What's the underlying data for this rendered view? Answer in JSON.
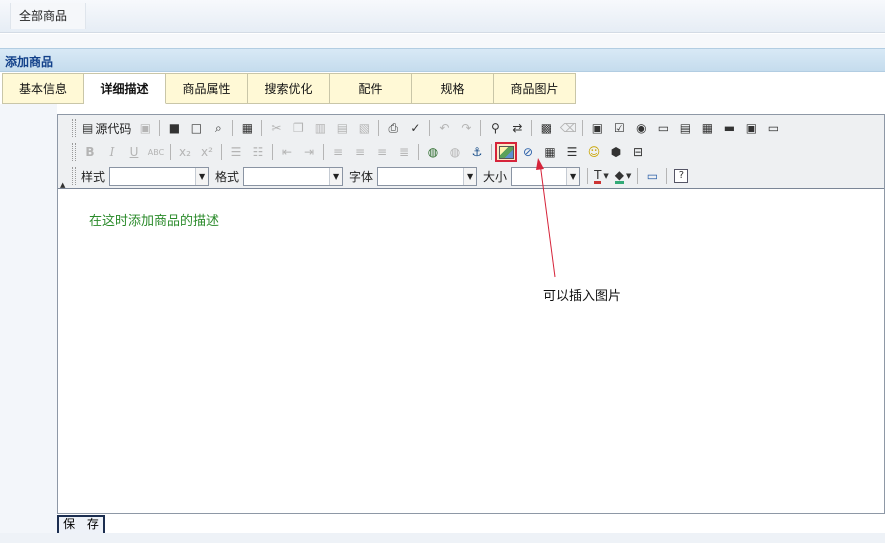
{
  "breadcrumb": "全部商品",
  "panel_title": "添加商品",
  "tabs": [
    {
      "label": "基本信息"
    },
    {
      "label": "详细描述",
      "active": true
    },
    {
      "label": "商品属性"
    },
    {
      "label": "搜索优化"
    },
    {
      "label": "配件"
    },
    {
      "label": "规格"
    },
    {
      "label": "商品图片"
    }
  ],
  "toolbar": {
    "source_label": "源代码",
    "combos": [
      {
        "label": "样式",
        "value": ""
      },
      {
        "label": "格式",
        "value": ""
      },
      {
        "label": "字体",
        "value": ""
      },
      {
        "label": "大小",
        "value": ""
      }
    ]
  },
  "editor": {
    "content_text": "在这时添加商品的描述"
  },
  "annotation": {
    "text": "可以插入图片",
    "color": "#d6243a"
  },
  "save_label": "保 存"
}
